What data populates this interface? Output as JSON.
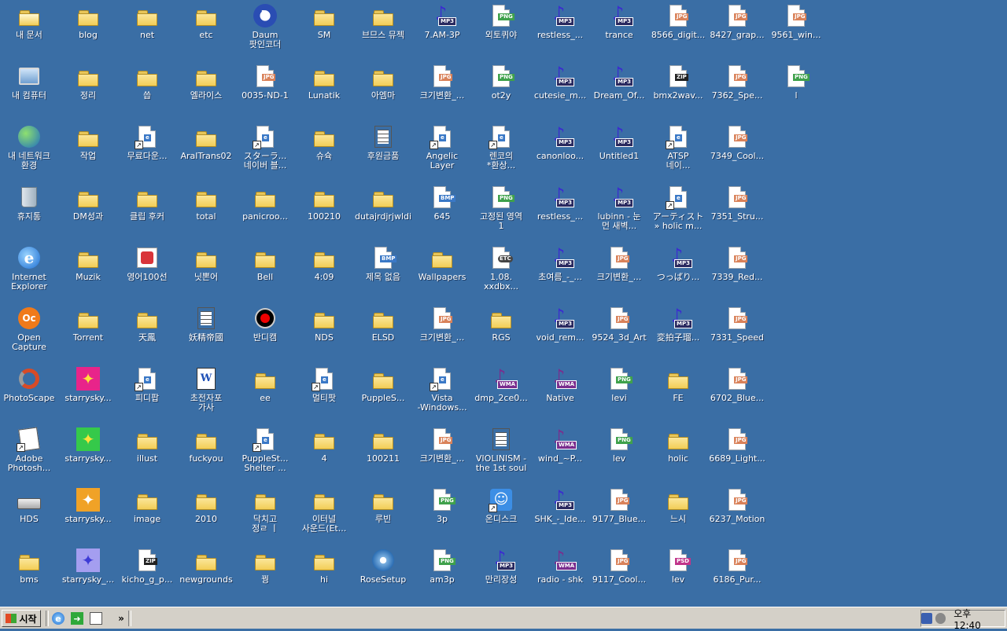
{
  "desktop": {
    "columns": [
      [
        {
          "label": "내 문서",
          "icon": "my-documents-icon"
        },
        {
          "label": "내 컴퓨터",
          "icon": "my-computer-icon"
        },
        {
          "label": "내 네트워크\n환경",
          "icon": "network-places-icon"
        },
        {
          "label": "휴지통",
          "icon": "recycle-bin-icon"
        },
        {
          "label": "Internet\nExplorer",
          "icon": "internet-explorer-icon"
        },
        {
          "label": "Open\nCapture",
          "icon": "open-capture-icon"
        },
        {
          "label": "PhotoScape",
          "icon": "photoscape-icon"
        },
        {
          "label": "Adobe\nPhotosh...",
          "icon": "photoshop-icon"
        },
        {
          "label": "HDS",
          "icon": "drive-icon"
        },
        {
          "label": "bms",
          "icon": "folder-icon"
        }
      ],
      [
        {
          "label": "blog",
          "icon": "folder-icon"
        },
        {
          "label": "정리",
          "icon": "folder-icon"
        },
        {
          "label": "작업",
          "icon": "folder-icon"
        },
        {
          "label": "DM성과",
          "icon": "folder-icon"
        },
        {
          "label": "Muzik",
          "icon": "folder-icon"
        },
        {
          "label": "Torrent",
          "icon": "folder-icon"
        },
        {
          "label": "starrysky...",
          "icon": "starry-pink-icon"
        },
        {
          "label": "starrysky...",
          "icon": "starry-green-icon"
        },
        {
          "label": "starrysky...",
          "icon": "starry-orange-icon"
        },
        {
          "label": "starrysky_...",
          "icon": "starry-violet-icon"
        }
      ],
      [
        {
          "label": "net",
          "icon": "folder-icon"
        },
        {
          "label": "씁",
          "icon": "folder-icon"
        },
        {
          "label": "무료다운...",
          "icon": "ie-shortcut-icon"
        },
        {
          "label": "클립 후커",
          "icon": "folder-icon"
        },
        {
          "label": "영어100선",
          "icon": "edu-app-icon"
        },
        {
          "label": "天鳳",
          "icon": "folder-icon"
        },
        {
          "label": "피디팝",
          "icon": "ie-shortcut-icon"
        },
        {
          "label": "illust",
          "icon": "folder-icon"
        },
        {
          "label": "image",
          "icon": "folder-icon"
        },
        {
          "label": "kicho_g_p...",
          "icon": "zip-icon"
        }
      ],
      [
        {
          "label": "etc",
          "icon": "folder-icon"
        },
        {
          "label": "엘라이스",
          "icon": "folder-icon"
        },
        {
          "label": "AraITrans02",
          "icon": "folder-icon"
        },
        {
          "label": "total",
          "icon": "folder-icon"
        },
        {
          "label": "닛뽄어",
          "icon": "folder-icon"
        },
        {
          "label": "妖精帝國",
          "icon": "music-doc-icon"
        },
        {
          "label": "초전자포\n가사",
          "icon": "word-doc-icon"
        },
        {
          "label": "fuckyou",
          "icon": "folder-icon"
        },
        {
          "label": "2010",
          "icon": "folder-icon"
        },
        {
          "label": "newgrounds",
          "icon": "folder-icon"
        }
      ],
      [
        {
          "label": "Daum\n팟인코더",
          "icon": "daum-potencoder-icon"
        },
        {
          "label": "0035-ND-1",
          "icon": "jpg-icon"
        },
        {
          "label": "スターラ...\n네이버 블...",
          "icon": "ie-shortcut-icon"
        },
        {
          "label": "panicroo...",
          "icon": "folder-icon"
        },
        {
          "label": "Bell",
          "icon": "folder-icon"
        },
        {
          "label": "반디캠",
          "icon": "bandicam-icon"
        },
        {
          "label": "ee",
          "icon": "folder-icon"
        },
        {
          "label": "PuppleSt...\nShelter ...",
          "icon": "ie-shortcut-icon"
        },
        {
          "label": "닥치고\n정ㄹ ㅣ",
          "icon": "folder-icon"
        },
        {
          "label": "꿩",
          "icon": "folder-icon"
        }
      ],
      [
        {
          "label": "SM",
          "icon": "folder-icon"
        },
        {
          "label": "Lunatik",
          "icon": "folder-icon"
        },
        {
          "label": "슈슉",
          "icon": "folder-icon"
        },
        {
          "label": "100210",
          "icon": "folder-icon"
        },
        {
          "label": "4:09",
          "icon": "folder-icon"
        },
        {
          "label": "NDS",
          "icon": "folder-icon"
        },
        {
          "label": "멀티팟",
          "icon": "ie-shortcut-icon"
        },
        {
          "label": "4",
          "icon": "folder-icon"
        },
        {
          "label": "이터널\n사운드(Et...",
          "icon": "folder-icon"
        },
        {
          "label": "hi",
          "icon": "folder-icon"
        }
      ],
      [
        {
          "label": "브므스 뮤젝",
          "icon": "folder-icon"
        },
        {
          "label": "아엠마",
          "icon": "folder-icon"
        },
        {
          "label": "후원금품",
          "icon": "text-doc-icon"
        },
        {
          "label": "dutajrdjrjwldi",
          "icon": "folder-icon"
        },
        {
          "label": "제목 없음",
          "icon": "bmp-icon"
        },
        {
          "label": "ELSD",
          "icon": "folder-icon"
        },
        {
          "label": "PuppleS...",
          "icon": "folder-icon"
        },
        {
          "label": "100211",
          "icon": "folder-icon"
        },
        {
          "label": "루빈",
          "icon": "folder-icon"
        },
        {
          "label": "RoseSetup",
          "icon": "setup-disk-icon"
        }
      ],
      [
        {
          "label": "7.AM-3P",
          "icon": "mp3-icon"
        },
        {
          "label": "크기변환_...",
          "icon": "jpg-icon"
        },
        {
          "label": "Angelic\nLayer",
          "icon": "ie-shortcut-icon"
        },
        {
          "label": "645",
          "icon": "bmp-icon"
        },
        {
          "label": "Wallpapers",
          "icon": "folder-icon"
        },
        {
          "label": "크기변환_...",
          "icon": "jpg-icon"
        },
        {
          "label": "Vista\n-Windows...",
          "icon": "ie-shortcut-icon"
        },
        {
          "label": "크기변환_...",
          "icon": "jpg-icon"
        },
        {
          "label": "3p",
          "icon": "png-icon"
        },
        {
          "label": "am3p",
          "icon": "png-icon"
        }
      ],
      [
        {
          "label": "외토퀴야",
          "icon": "png-icon"
        },
        {
          "label": "ot2y",
          "icon": "png-icon"
        },
        {
          "label": "렌코의\n*환상...",
          "icon": "ie-shortcut-icon"
        },
        {
          "label": "고정된 영역\n1",
          "icon": "png-icon"
        },
        {
          "label": "1.08.\nxxdbx...",
          "icon": "etc-icon"
        },
        {
          "label": "RGS",
          "icon": "folder-icon"
        },
        {
          "label": "dmp_2ce0...",
          "icon": "wma-icon"
        },
        {
          "label": "VIOLINISM -\nthe 1st soul",
          "icon": "text-doc-icon"
        },
        {
          "label": "온디스크",
          "icon": "ondisk-icon"
        },
        {
          "label": "만리장성",
          "icon": "mp3-icon"
        }
      ],
      [
        {
          "label": "restless_...",
          "icon": "mp3-icon"
        },
        {
          "label": "cutesie_m...",
          "icon": "mp3-icon"
        },
        {
          "label": "canonloo...",
          "icon": "mp3-icon"
        },
        {
          "label": "restless_...",
          "icon": "mp3-icon"
        },
        {
          "label": "초여름_-_...",
          "icon": "mp3-icon"
        },
        {
          "label": "void_rem...",
          "icon": "mp3-icon"
        },
        {
          "label": "Native",
          "icon": "wma-icon"
        },
        {
          "label": "wind_~P...",
          "icon": "wma-icon"
        },
        {
          "label": "SHK_-_Ide...",
          "icon": "mp3-icon"
        },
        {
          "label": "radio - shk",
          "icon": "wma-icon"
        }
      ],
      [
        {
          "label": "trance",
          "icon": "mp3-icon"
        },
        {
          "label": "Dream_Of...",
          "icon": "mp3-icon"
        },
        {
          "label": "Untitled1",
          "icon": "mp3-icon"
        },
        {
          "label": "lubinn - 눈\n먼 새벽...",
          "icon": "mp3-icon"
        },
        {
          "label": "크기변환_...",
          "icon": "jpg-icon"
        },
        {
          "label": "9524_3d_Art",
          "icon": "jpg-icon"
        },
        {
          "label": "levi",
          "icon": "png-icon"
        },
        {
          "label": "lev",
          "icon": "png-icon"
        },
        {
          "label": "9177_Blue...",
          "icon": "jpg-icon"
        },
        {
          "label": "9117_Cool...",
          "icon": "jpg-icon"
        }
      ],
      [
        {
          "label": "8566_digit...",
          "icon": "jpg-icon"
        },
        {
          "label": "bmx2wav...",
          "icon": "zip-icon"
        },
        {
          "label": "ATSP\n네이...",
          "icon": "ie-shortcut-icon"
        },
        {
          "label": "アーティスト\n» holic  m...",
          "icon": "ie-shortcut-icon"
        },
        {
          "label": "つっぱり...",
          "icon": "mp3-icon"
        },
        {
          "label": "変拍子瑠...",
          "icon": "mp3-icon"
        },
        {
          "label": "FE",
          "icon": "folder-icon"
        },
        {
          "label": "holic",
          "icon": "folder-icon"
        },
        {
          "label": "느시",
          "icon": "folder-icon"
        },
        {
          "label": "lev",
          "icon": "psd-icon"
        }
      ],
      [
        {
          "label": "8427_grap...",
          "icon": "jpg-icon"
        },
        {
          "label": "7362_Spe...",
          "icon": "jpg-icon"
        },
        {
          "label": "7349_Cool...",
          "icon": "jpg-icon"
        },
        {
          "label": "7351_Stru...",
          "icon": "jpg-icon"
        },
        {
          "label": "7339_Red...",
          "icon": "jpg-icon"
        },
        {
          "label": "7331_Speed",
          "icon": "jpg-icon"
        },
        {
          "label": "6702_Blue...",
          "icon": "jpg-icon"
        },
        {
          "label": "6689_Light...",
          "icon": "jpg-icon"
        },
        {
          "label": "6237_Motion",
          "icon": "jpg-icon"
        },
        {
          "label": "6186_Pur...",
          "icon": "jpg-icon"
        }
      ],
      [
        {
          "label": "9561_win...",
          "icon": "jpg-icon"
        },
        {
          "label": "l",
          "icon": "png-icon"
        }
      ]
    ]
  },
  "taskbar": {
    "start_label": "시작",
    "quick_launch_more": "»",
    "clock": "오후 12:40"
  }
}
